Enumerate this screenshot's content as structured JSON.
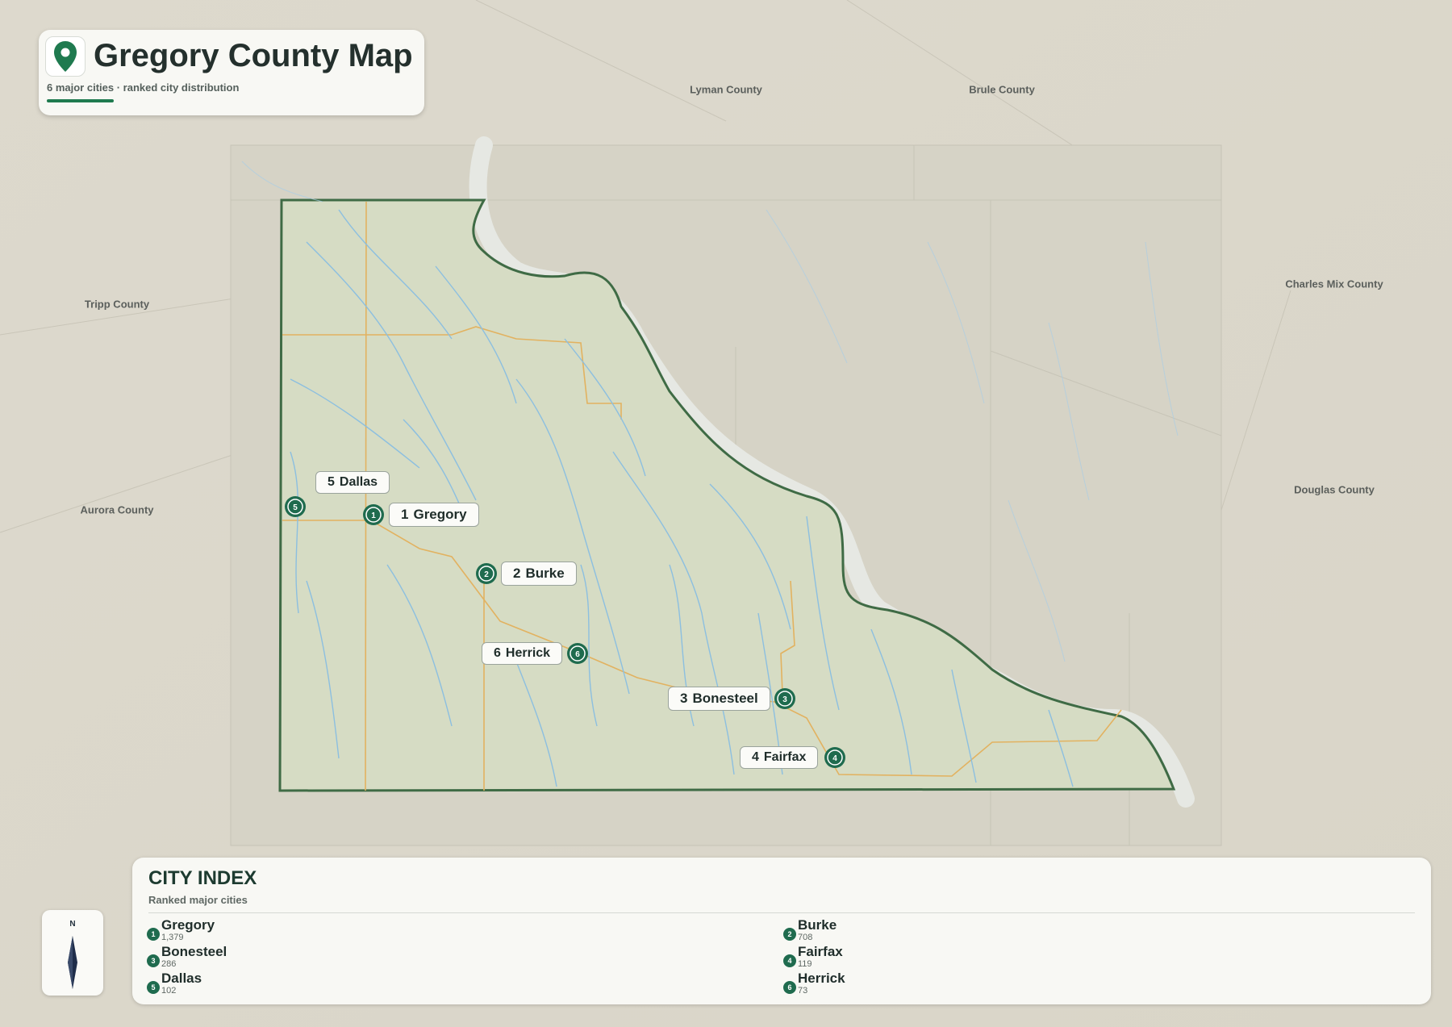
{
  "title": {
    "text": "Gregory County Map",
    "subtitle": "6 major cities · ranked city distribution",
    "icon": "map-pin-icon"
  },
  "neighbors": [
    {
      "name": "Lyman County"
    },
    {
      "name": "Brule County"
    },
    {
      "name": "Tripp County"
    },
    {
      "name": "Charles Mix County"
    },
    {
      "name": "Aurora County"
    },
    {
      "name": "Douglas County"
    }
  ],
  "cities": [
    {
      "rank": "1",
      "name": "Gregory",
      "population": "1,379"
    },
    {
      "rank": "2",
      "name": "Burke",
      "population": "708"
    },
    {
      "rank": "3",
      "name": "Bonesteel",
      "population": "286"
    },
    {
      "rank": "4",
      "name": "Fairfax",
      "population": "119"
    },
    {
      "rank": "5",
      "name": "Dallas",
      "population": "102"
    },
    {
      "rank": "6",
      "name": "Herrick",
      "population": "73"
    }
  ],
  "index": {
    "title": "CITY INDEX",
    "subtitle": "Ranked major cities"
  },
  "compass": {
    "north_label": "N"
  },
  "colors": {
    "county_fill": "#d8ddc6",
    "county_border": "#3f6b45",
    "river": "#7fb6db",
    "road": "#e8b45a",
    "accent": "#1f6b4e"
  }
}
